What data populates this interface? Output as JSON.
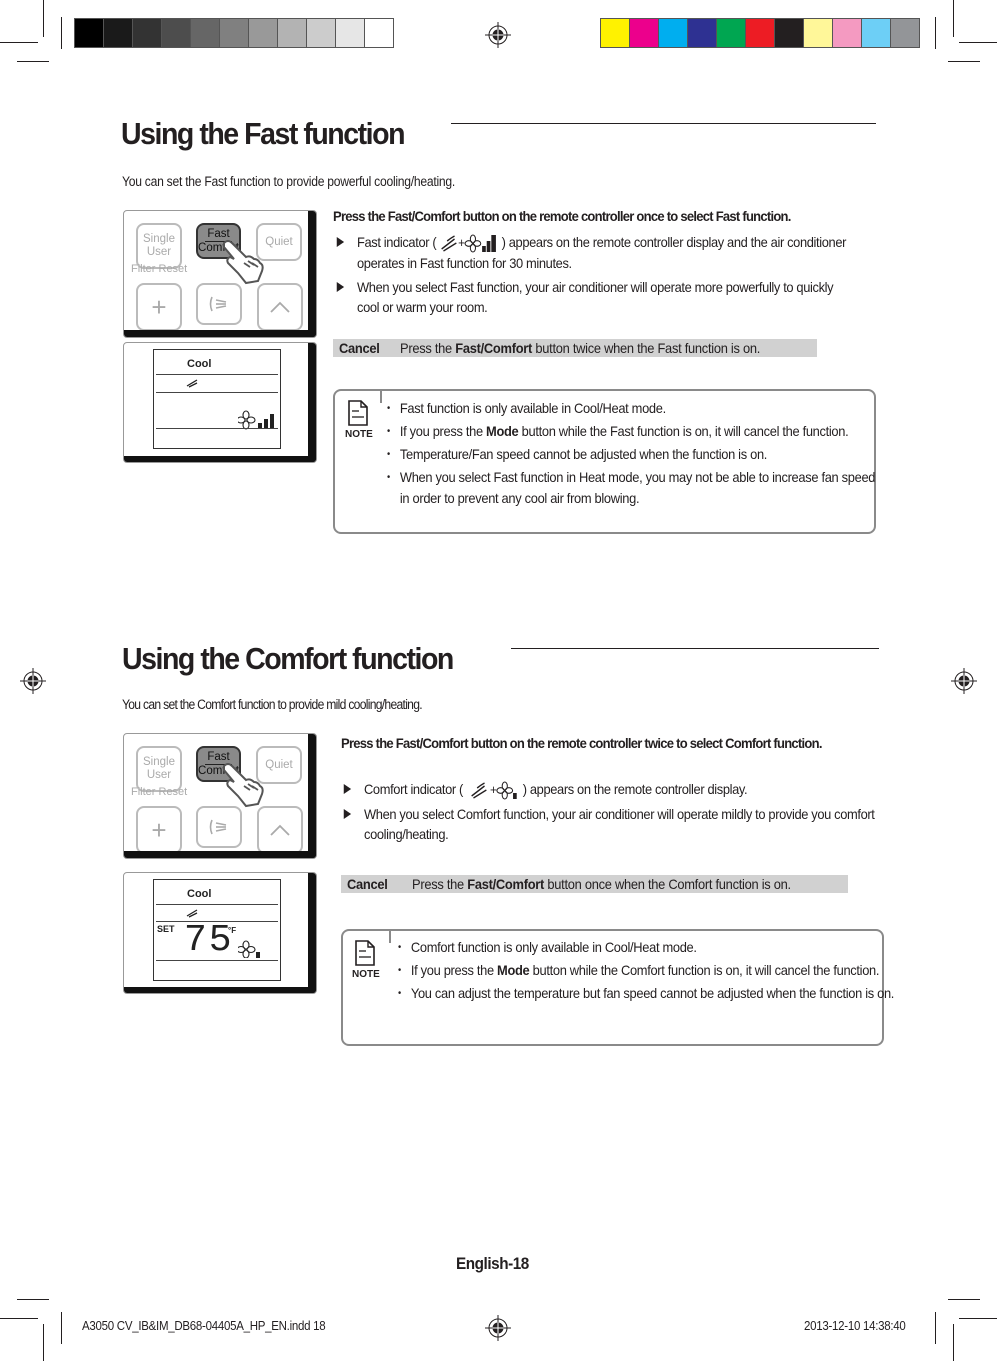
{
  "print_marks": {
    "gray_swatches": [
      "#000000",
      "#1a1a1a",
      "#333333",
      "#4d4d4d",
      "#666666",
      "#808080",
      "#999999",
      "#b3b3b3",
      "#cccccc",
      "#e6e6e6",
      "#ffffff"
    ],
    "color_swatches": [
      "#fff200",
      "#ec008c",
      "#00aeef",
      "#2e3192",
      "#00a651",
      "#ed1c24",
      "#231f20",
      "#fff799",
      "#f49ac1",
      "#6dcff6",
      "#939598"
    ]
  },
  "fast": {
    "title": "Using the Fast function",
    "intro": "You can set the Fast function to provide powerful cooling/heating.",
    "remote": {
      "btn_single_1": "Single",
      "btn_single_2": "User",
      "btn_fast_1": "Fast",
      "btn_fast_2": "Comfort",
      "btn_quiet": "Quiet",
      "filter_reset": "Filter Reset",
      "btn_plus": "+",
      "btn_caret": "^"
    },
    "display": {
      "mode": "Cool",
      "fan_level_bars": 3
    },
    "lead": "Press the Fast/Comfort button on the remote controller once to select Fast function.",
    "bullets": [
      {
        "pre": "Fast indicator (",
        "post": ")  appears on the remote controller display and the air conditioner operates in Fast function for 30 minutes."
      },
      {
        "text": "When you select Fast function, your air conditioner will operate more powerfully to quickly cool or warm your room."
      }
    ],
    "cancel": {
      "label": "Cancel",
      "pre": "Press the ",
      "bold": "Fast/Comfort",
      "post": " button twice when the Fast function is on."
    },
    "note": {
      "icon_label": "NOTE",
      "items": [
        {
          "text": "Fast function is only available in Cool/Heat mode."
        },
        {
          "pre": "If you press the ",
          "bold": "Mode",
          "post": " button while the Fast function is on, it will cancel the function."
        },
        {
          "text": "Temperature/Fan speed cannot be adjusted when the function is on."
        },
        {
          "text": "When you select Fast function in Heat mode, you may not be able to increase fan speed in order to prevent any cool air from blowing."
        }
      ]
    }
  },
  "comfort": {
    "title": "Using the Comfort function",
    "intro": "You can set the Comfort function to provide mild cooling/heating.",
    "remote": {
      "btn_single_1": "Single",
      "btn_single_2": "User",
      "btn_fast_1": "Fast",
      "btn_fast_2": "Comfort",
      "btn_quiet": "Quiet",
      "filter_reset": "Filter Reset",
      "btn_plus": "+",
      "btn_caret": "^"
    },
    "display": {
      "mode": "Cool",
      "set_label": "SET",
      "temperature": "75",
      "unit": "°F",
      "fan_level_bars": 1
    },
    "lead": "Press the Fast/Comfort button on the remote controller twice to select Comfort function.",
    "bullets": [
      {
        "pre": "Comfort indicator ( ",
        "post": " ) appears on the remote controller display."
      },
      {
        "text": "When you select Comfort function, your air conditioner will operate mildly to provide you comfort cooling/heating."
      }
    ],
    "cancel": {
      "label": "Cancel",
      "pre": "Press the ",
      "bold": "Fast/Comfort",
      "post": " button once when the Comfort function is on."
    },
    "note": {
      "icon_label": "NOTE",
      "items": [
        {
          "text": "Comfort function is only available in Cool/Heat mode."
        },
        {
          "pre": "If you press the ",
          "bold": "Mode",
          "post": " button while the Comfort function is on, it will cancel the function."
        },
        {
          "text": "You can adjust the temperature but fan speed cannot be adjusted when the function is on."
        }
      ]
    }
  },
  "footer": {
    "page_label": "English-18",
    "slug_file": "A3050 CV_IB&IM_DB68-04405A_HP_EN.indd   18",
    "slug_date": "2013-12-10   14:38:40"
  }
}
